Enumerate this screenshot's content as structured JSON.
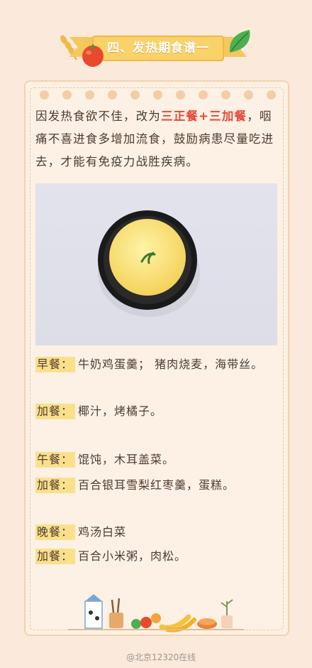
{
  "header": {
    "title": "四、发热期食谱一"
  },
  "intro": {
    "part1": "因发热食欲不佳，改为",
    "highlight": "三正餐+三加餐",
    "part2": "，咽痛不喜进食多增加流食，鼓励病患尽量吃进去，才能有免疫力战胜疾病。"
  },
  "photo": {
    "icon": "steamed-egg-custard-image"
  },
  "meals": [
    {
      "label": "早餐：",
      "text": "牛奶鸡蛋羹； 猪肉烧麦，海带丝。"
    },
    {
      "label": "加餐：",
      "text": "椰汁，烤橘子。"
    },
    {
      "label": "午餐：",
      "text": "馄饨，木耳盖菜。"
    },
    {
      "label": "加餐：",
      "text": "百合银耳雪梨红枣羹，蛋糕。"
    },
    {
      "label": "晚餐：",
      "text": "鸡汤白菜"
    },
    {
      "label": "加餐：",
      "text": "百合小米粥，肉松。"
    }
  ],
  "watermark": "@北京12320在线"
}
